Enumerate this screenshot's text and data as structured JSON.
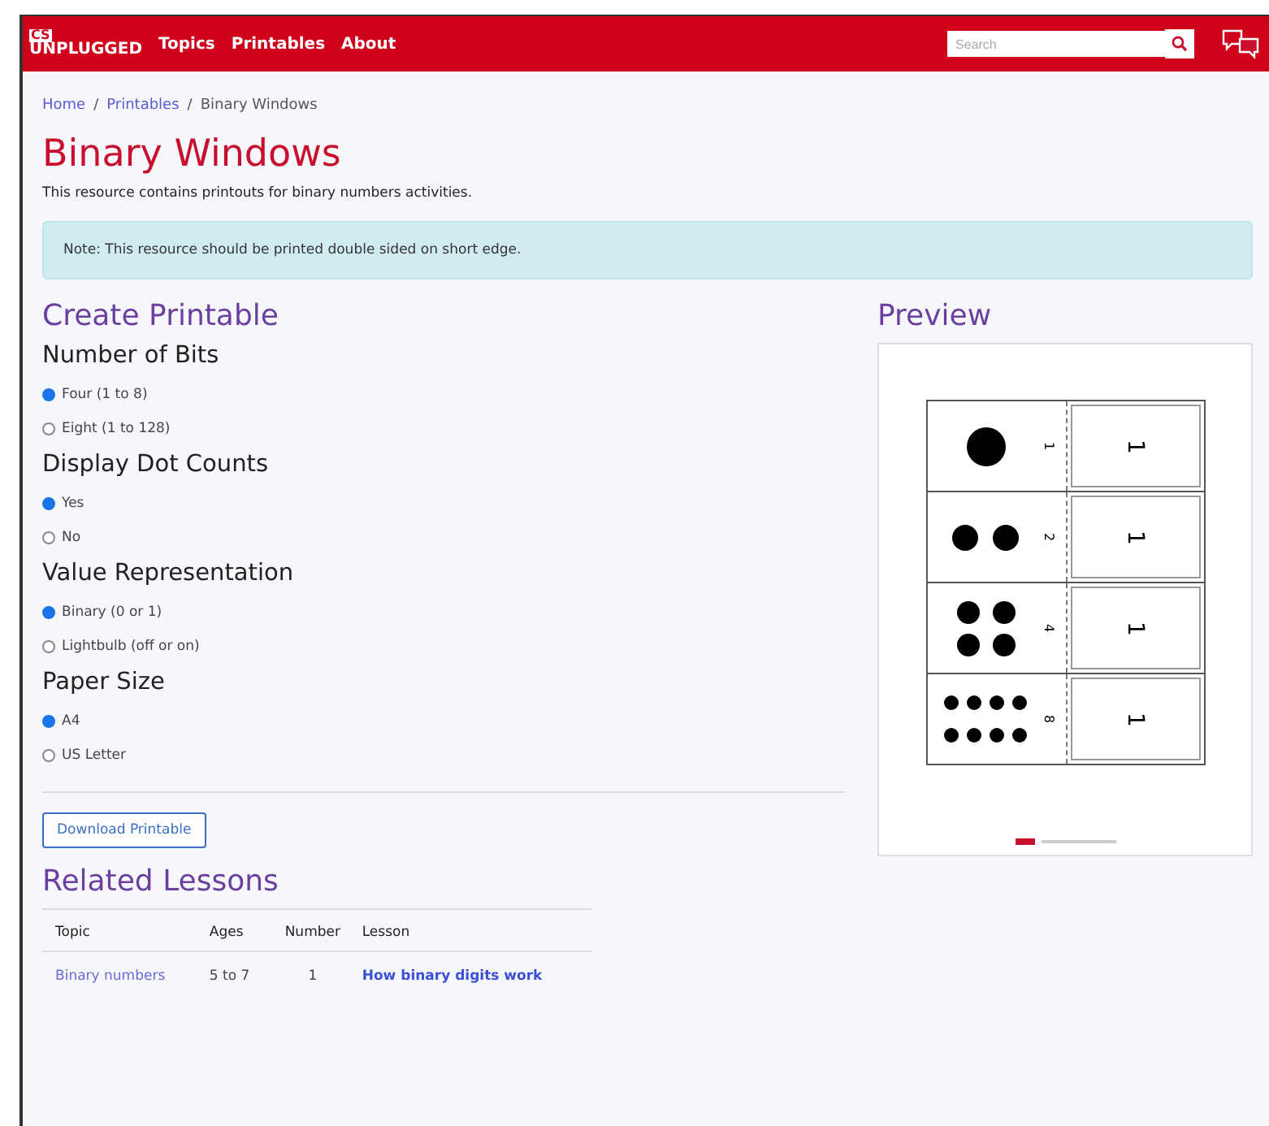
{
  "navbar": {
    "logo_top": "CS",
    "logo_bottom": "UNPLUGGED",
    "links": [
      "Topics",
      "Printables",
      "About"
    ],
    "search": {
      "placeholder": "Search"
    }
  },
  "breadcrumb_separator": "/",
  "breadcrumb": [
    {
      "label": "Home",
      "link": true
    },
    {
      "label": "Printables",
      "link": true
    },
    {
      "label": "Binary Windows",
      "link": false
    }
  ],
  "title": "Binary Windows",
  "description": "This resource contains printouts for binary numbers activities.",
  "note": "Note: This resource should be printed double sided on short edge.",
  "create": {
    "heading": "Create Printable",
    "groups": [
      {
        "label": "Number of Bits",
        "options": [
          {
            "label": "Four (1 to 8)",
            "selected": true
          },
          {
            "label": "Eight (1 to 128)",
            "selected": false
          }
        ]
      },
      {
        "label": "Display Dot Counts",
        "options": [
          {
            "label": "Yes",
            "selected": true
          },
          {
            "label": "No",
            "selected": false
          }
        ]
      },
      {
        "label": "Value Representation",
        "options": [
          {
            "label": "Binary (0 or 1)",
            "selected": true
          },
          {
            "label": "Lightbulb (off or on)",
            "selected": false
          }
        ]
      },
      {
        "label": "Paper Size",
        "options": [
          {
            "label": "A4",
            "selected": true
          },
          {
            "label": "US Letter",
            "selected": false
          }
        ]
      }
    ],
    "button": "Download Printable"
  },
  "related": {
    "heading": "Related Lessons",
    "columns": [
      "Topic",
      "Ages",
      "Number",
      "Lesson"
    ],
    "rows": [
      {
        "topic": "Binary numbers",
        "ages": "5 to 7",
        "number": "1",
        "lesson": "How binary digits work"
      }
    ]
  },
  "preview": {
    "heading": "Preview",
    "cards": [
      {
        "count": "1",
        "value": "1"
      },
      {
        "count": "2",
        "value": "1"
      },
      {
        "count": "4",
        "value": "1"
      },
      {
        "count": "8",
        "value": "1"
      }
    ]
  }
}
